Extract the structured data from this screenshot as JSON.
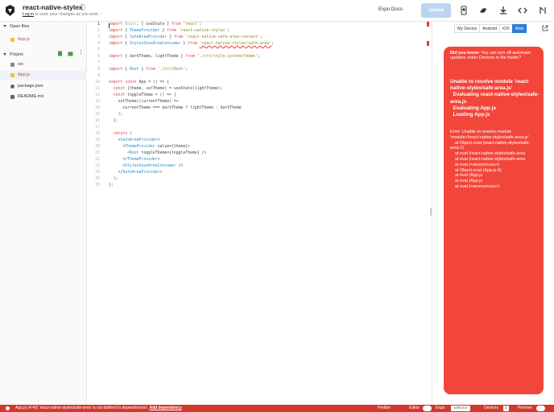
{
  "header": {
    "title": "react-native-stylex",
    "subtitle_link": "Log in",
    "subtitle_rest": " to save your changes as you work",
    "expo_docs": "Expo Docs",
    "saved": "Saved"
  },
  "sidebar": {
    "open_files_label": "Open files",
    "open_files": [
      {
        "name": "App.js"
      }
    ],
    "project_label": "Project",
    "project_files": [
      {
        "name": "src",
        "kind": "folder"
      },
      {
        "name": "App.js",
        "kind": "js"
      },
      {
        "name": "package.json",
        "kind": "json"
      },
      {
        "name": "README.md",
        "kind": "md"
      }
    ]
  },
  "editor": {
    "line_numbers": [
      "1",
      "2",
      "3",
      "4",
      "5",
      "6",
      "7",
      "8",
      "9",
      "10",
      "11",
      "12",
      "13",
      "14",
      "15",
      "16",
      "17",
      "18",
      "19",
      "20",
      "21",
      "22",
      "23",
      "24",
      "25",
      "26"
    ],
    "lines": [
      [
        {
          "t": "import ",
          "c": "kw"
        },
        {
          "t": "React",
          "c": "dim"
        },
        {
          "t": ", { useState } ",
          "c": "id"
        },
        {
          "t": "from ",
          "c": "kw"
        },
        {
          "t": "'react'",
          "c": "str"
        },
        {
          "t": ";",
          "c": "id"
        }
      ],
      [
        {
          "t": "import ",
          "c": "kw"
        },
        {
          "t": "{ ",
          "c": "id"
        },
        {
          "t": "ThemeProvider",
          "c": "cmp"
        },
        {
          "t": " } ",
          "c": "id"
        },
        {
          "t": "from ",
          "c": "kw"
        },
        {
          "t": "'react-native-stylex'",
          "c": "str"
        },
        {
          "t": ";",
          "c": "id"
        }
      ],
      [
        {
          "t": "import ",
          "c": "kw"
        },
        {
          "t": "{ ",
          "c": "id"
        },
        {
          "t": "SafeAreaProvider",
          "c": "cmp"
        },
        {
          "t": " } ",
          "c": "id"
        },
        {
          "t": "from ",
          "c": "kw"
        },
        {
          "t": "'react-native-safe-area-context'",
          "c": "str"
        },
        {
          "t": ";",
          "c": "id"
        }
      ],
      [
        {
          "t": "import ",
          "c": "kw"
        },
        {
          "t": "{ ",
          "c": "id"
        },
        {
          "t": "StylexSaveAreaConsumer",
          "c": "cmp"
        },
        {
          "t": " } ",
          "c": "id"
        },
        {
          "t": "from ",
          "c": "kw"
        },
        {
          "t": "'react-native-stylex/safe-area'",
          "c": "str"
        },
        {
          "t": ";",
          "c": "id"
        }
      ],
      [],
      [
        {
          "t": "import ",
          "c": "kw"
        },
        {
          "t": "{ darkTheme, lightTheme } ",
          "c": "id"
        },
        {
          "t": "from ",
          "c": "kw"
        },
        {
          "t": "'./src/style-system/theme'",
          "c": "str"
        },
        {
          "t": ";",
          "c": "id"
        }
      ],
      [],
      [
        {
          "t": "import ",
          "c": "kw"
        },
        {
          "t": "{ ",
          "c": "id"
        },
        {
          "t": "Root",
          "c": "cmp"
        },
        {
          "t": " } ",
          "c": "id"
        },
        {
          "t": "from ",
          "c": "kw"
        },
        {
          "t": "'./src/Root'",
          "c": "str"
        },
        {
          "t": ";",
          "c": "id"
        }
      ],
      [],
      [
        {
          "t": "export ",
          "c": "kw"
        },
        {
          "t": "const ",
          "c": "kw"
        },
        {
          "t": "App = () => {",
          "c": "id"
        }
      ],
      [
        {
          "t": "  const ",
          "c": "kw"
        },
        {
          "t": "[theme, setTheme] = useState(lightTheme);",
          "c": "id"
        }
      ],
      [
        {
          "t": "  const ",
          "c": "kw"
        },
        {
          "t": "toggleTheme = () => {",
          "c": "id"
        }
      ],
      [
        {
          "t": "    setTheme((currentTheme) =>",
          "c": "id"
        }
      ],
      [
        {
          "t": "      currentTheme === darkTheme ? lightTheme : darkTheme",
          "c": "id"
        }
      ],
      [
        {
          "t": "    );",
          "c": "id"
        }
      ],
      [
        {
          "t": "  };",
          "c": "id"
        }
      ],
      [],
      [
        {
          "t": "  return ",
          "c": "kw"
        },
        {
          "t": "(",
          "c": "id"
        }
      ],
      [
        {
          "t": "    <",
          "c": "id"
        },
        {
          "t": "SafeAreaProvider",
          "c": "cmp"
        },
        {
          "t": ">",
          "c": "id"
        }
      ],
      [
        {
          "t": "      <",
          "c": "id"
        },
        {
          "t": "ThemeProvider",
          "c": "cmp"
        },
        {
          "t": " value={theme}>",
          "c": "id"
        }
      ],
      [
        {
          "t": "        <",
          "c": "id"
        },
        {
          "t": "Root",
          "c": "cmp"
        },
        {
          "t": " toggleTheme={toggleTheme} />",
          "c": "id"
        }
      ],
      [
        {
          "t": "      </",
          "c": "id"
        },
        {
          "t": "ThemeProvider",
          "c": "cmp"
        },
        {
          "t": ">",
          "c": "id"
        }
      ],
      [
        {
          "t": "      <",
          "c": "id"
        },
        {
          "t": "StylexSaveAreaConsumer",
          "c": "cmp"
        },
        {
          "t": " />",
          "c": "id"
        }
      ],
      [
        {
          "t": "    </",
          "c": "id"
        },
        {
          "t": "SafeAreaProvider",
          "c": "cmp"
        },
        {
          "t": ">",
          "c": "id"
        }
      ],
      [
        {
          "t": "  );",
          "c": "id"
        }
      ],
      [
        {
          "t": "};",
          "c": "id"
        }
      ]
    ]
  },
  "preview": {
    "tabs": [
      {
        "label": "My Device",
        "active": false
      },
      {
        "label": "Android",
        "active": false
      },
      {
        "label": "iOS",
        "active": false
      },
      {
        "label": "Web",
        "active": true
      }
    ],
    "tip_bold": "Did you know:",
    "tip_text": " You can turn off automatic updates under Devices in the footer?",
    "error_title": "Unable to resolve module 'react-native-stylex/safe-area.js'\n  Evaluating react-native-stylex/safe-area.js\n  Evaluating App.js\n  Loading App.js",
    "error_body": "Error: Unable to resolve module 'module://react-native-stylex/safe-area.js'\n    at Object.eval (react-native-stylex/safe-area.1)\n    at eval (react-native-stylex/safe-area\n    at eval (react-native-stylex/safe-area\n    at eval (<anonymous>)\n    at Object.eval (App.js:4)\n    at eval (App.js\n    at eval (App.js\n    at eval (<anonymous>)"
  },
  "statusbar": {
    "message": "App.js (4:40) 'react-native-stylex/safe-area' is not defined in dependencies.",
    "action": "Add dependency",
    "prettier": "Prettier",
    "editor": "Editor",
    "expo": "Expo",
    "version": "v49.0.0",
    "devices": "Devices",
    "devices_count": "1",
    "preview": "Preview"
  },
  "colors": {
    "accent": "#2a7dd8",
    "error": "#f2463a",
    "statusbar": "#d0392e"
  }
}
